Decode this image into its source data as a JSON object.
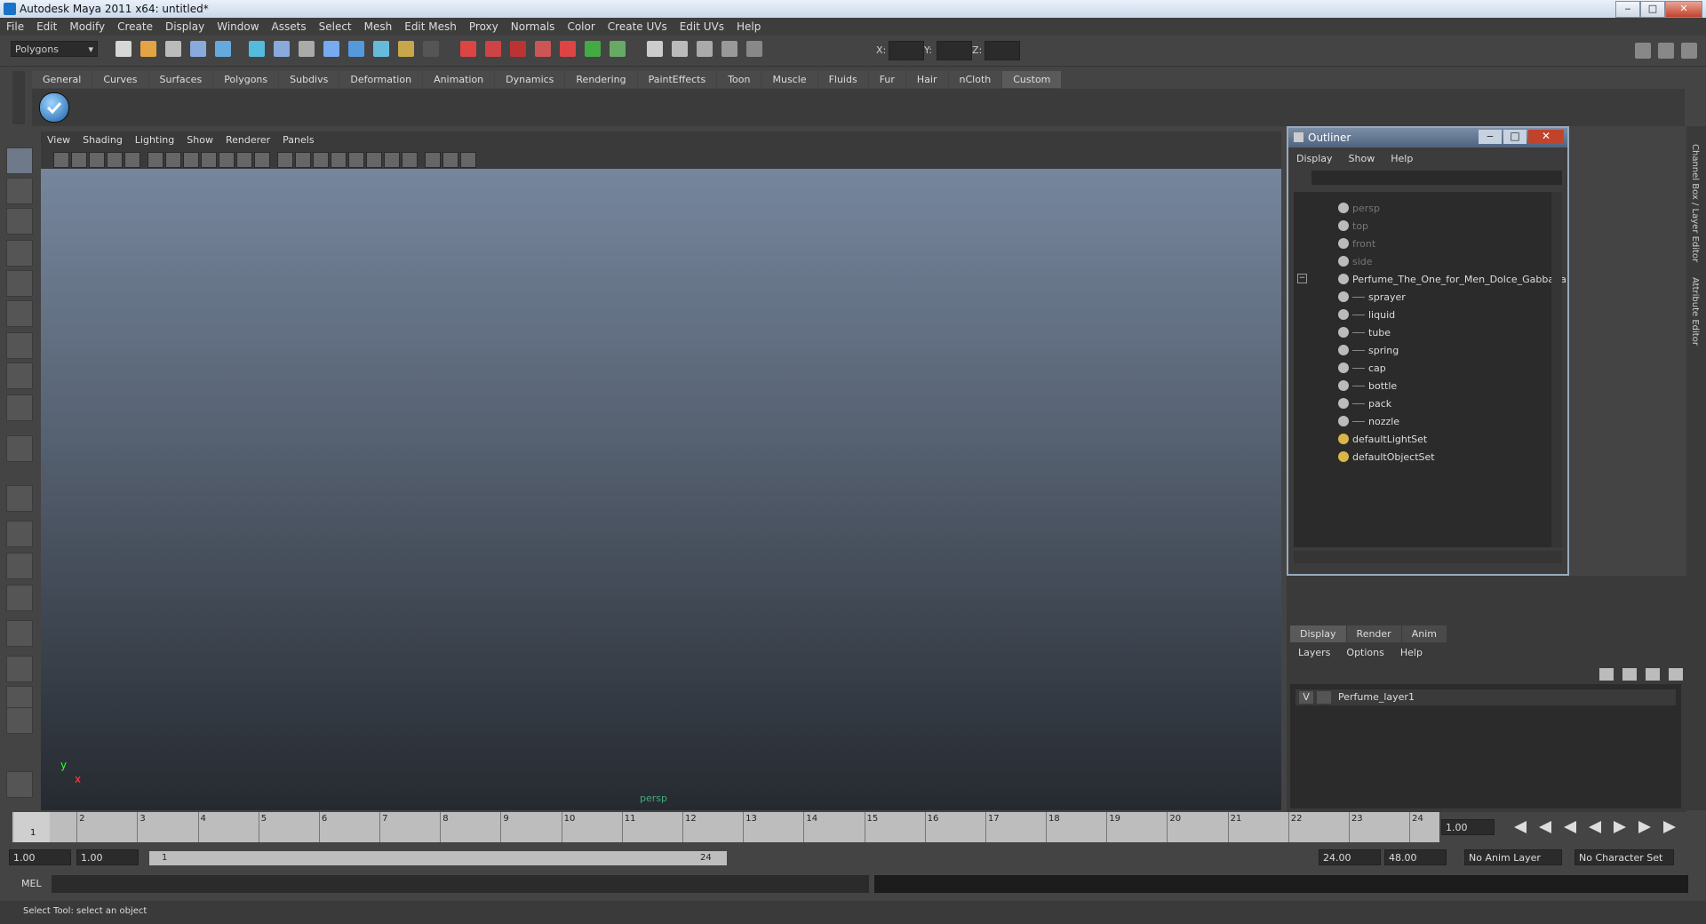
{
  "window": {
    "title": "Autodesk Maya 2011 x64: untitled*",
    "min": "‒",
    "max": "□",
    "close": "✕"
  },
  "menubar": [
    "File",
    "Edit",
    "Modify",
    "Create",
    "Display",
    "Window",
    "Assets",
    "Select",
    "Mesh",
    "Edit Mesh",
    "Proxy",
    "Normals",
    "Color",
    "Create UVs",
    "Edit UVs",
    "Help"
  ],
  "statusline": {
    "mode": "Polygons",
    "x_label": "X:",
    "y_label": "Y:",
    "z_label": "Z:"
  },
  "shelf": {
    "tabs": [
      "General",
      "Curves",
      "Surfaces",
      "Polygons",
      "Subdivs",
      "Deformation",
      "Animation",
      "Dynamics",
      "Rendering",
      "PaintEffects",
      "Toon",
      "Muscle",
      "Fluids",
      "Fur",
      "Hair",
      "nCloth",
      "Custom"
    ],
    "active": "Custom"
  },
  "viewport": {
    "menu": [
      "View",
      "Shading",
      "Lighting",
      "Show",
      "Renderer",
      "Panels"
    ],
    "axis_y": "y",
    "axis_x": "x",
    "camera_label": "persp"
  },
  "outliner": {
    "title": "Outliner",
    "menu": [
      "Display",
      "Show",
      "Help"
    ],
    "items": [
      {
        "label": "persp",
        "dim": true,
        "indent": 0
      },
      {
        "label": "top",
        "dim": true,
        "indent": 0
      },
      {
        "label": "front",
        "dim": true,
        "indent": 0
      },
      {
        "label": "side",
        "dim": true,
        "indent": 0
      },
      {
        "label": "Perfume_The_One_for_Men_Dolce_Gabbana",
        "dim": false,
        "indent": 0,
        "group": true
      },
      {
        "label": "sprayer",
        "dim": false,
        "indent": 1
      },
      {
        "label": "liquid",
        "dim": false,
        "indent": 1
      },
      {
        "label": "tube",
        "dim": false,
        "indent": 1
      },
      {
        "label": "spring",
        "dim": false,
        "indent": 1
      },
      {
        "label": "cap",
        "dim": false,
        "indent": 1
      },
      {
        "label": "bottle",
        "dim": false,
        "indent": 1
      },
      {
        "label": "pack",
        "dim": false,
        "indent": 1
      },
      {
        "label": "nozzle",
        "dim": false,
        "indent": 1
      },
      {
        "label": "defaultLightSet",
        "dim": false,
        "indent": 0
      },
      {
        "label": "defaultObjectSet",
        "dim": false,
        "indent": 0
      }
    ]
  },
  "layers": {
    "tabs": [
      "Display",
      "Render",
      "Anim"
    ],
    "active": "Display",
    "menu": [
      "Layers",
      "Options",
      "Help"
    ],
    "rows": [
      {
        "visible": "V",
        "name": "Perfume_layer1"
      }
    ]
  },
  "channel_strip": {
    "channel_box": "Channel Box / Layer Editor",
    "attribute_editor": "Attribute Editor"
  },
  "timeline": {
    "ticks": [
      1,
      2,
      3,
      4,
      5,
      6,
      7,
      8,
      9,
      10,
      11,
      12,
      13,
      14,
      15,
      16,
      17,
      18,
      19,
      20,
      21,
      22,
      23,
      24
    ],
    "current": "1",
    "current_time": "1.00"
  },
  "range": {
    "start_time": "1.00",
    "start_range": "1.00",
    "range_start_label": "1",
    "range_end_label": "24",
    "end_range": "24.00",
    "end_time": "48.00",
    "anim_layer": "No Anim Layer",
    "character_set": "No Character Set"
  },
  "command": {
    "label": "MEL"
  },
  "help": {
    "text": "Select Tool: select an object"
  },
  "colors": {
    "wire": "#0a0a80",
    "grid": "#8e939a",
    "accent": "#1c5fa6"
  }
}
